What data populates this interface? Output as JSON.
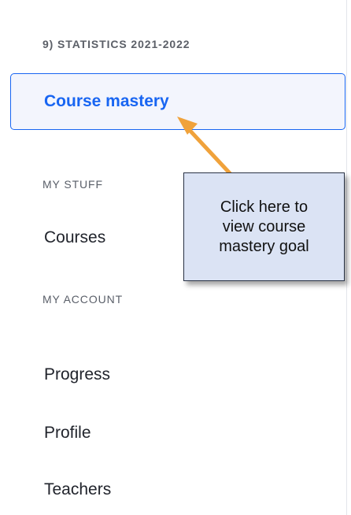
{
  "sidebar": {
    "course_title": "9) STATISTICS 2021-2022",
    "active_item": {
      "label": "Course mastery"
    },
    "my_stuff": {
      "title": "MY STUFF",
      "items": [
        {
          "label": "Courses"
        }
      ]
    },
    "my_account": {
      "title": "MY ACCOUNT",
      "items": [
        {
          "label": "Progress"
        },
        {
          "label": "Profile"
        },
        {
          "label": "Teachers"
        }
      ]
    }
  },
  "annotation": {
    "callout_text": "Click here to\nview course\nmastery goal",
    "arrow_color": "#f0a23b",
    "callout_background": "#dbe3f4"
  },
  "colors": {
    "accent": "#1865f2",
    "text": "#21242c",
    "muted": "#5c6068"
  }
}
